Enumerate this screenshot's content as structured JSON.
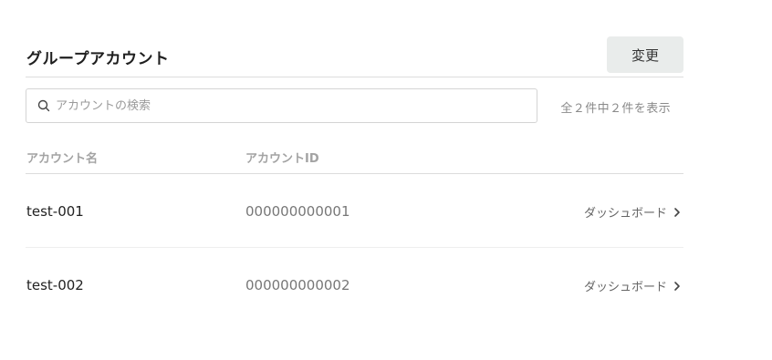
{
  "header": {
    "title": "グループアカウント",
    "change_label": "変更"
  },
  "search": {
    "placeholder": "アカウントの検索",
    "value": "",
    "result_count": "全２件中２件を表示"
  },
  "table": {
    "columns": [
      "アカウント名",
      "アカウントID"
    ],
    "rows": [
      {
        "name": "test-001",
        "id": "000000000001",
        "action": "ダッシュボード"
      },
      {
        "name": "test-002",
        "id": "000000000002",
        "action": "ダッシュボード"
      }
    ]
  },
  "icons": {
    "search": "search-icon",
    "chevron": "chevron-right-icon"
  },
  "colors": {
    "button_bg": "#e9eceb",
    "muted_text": "#a3a3a3",
    "border": "#dcdcdc"
  }
}
